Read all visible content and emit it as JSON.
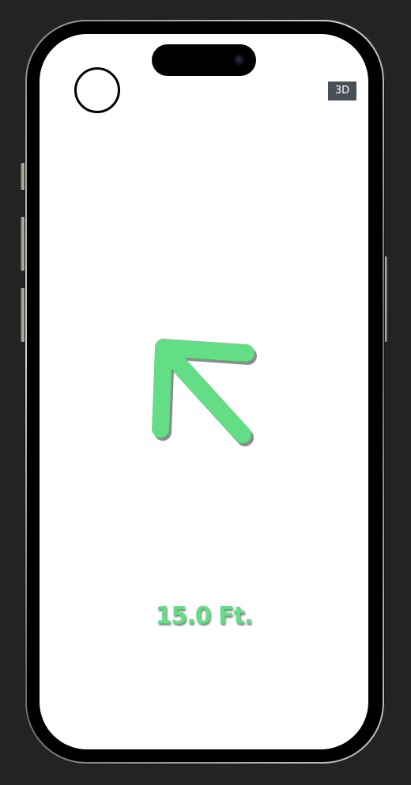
{
  "top_bar": {
    "mode_badge_label": "3D"
  },
  "navigation": {
    "direction_indicator": "arrow-up-left-icon",
    "distance_text": "15.0 Ft."
  },
  "colors": {
    "accent": "#63dd86",
    "badge_bg": "#4a5058",
    "screen_bg": "#ffffff",
    "backdrop": "#232323"
  }
}
